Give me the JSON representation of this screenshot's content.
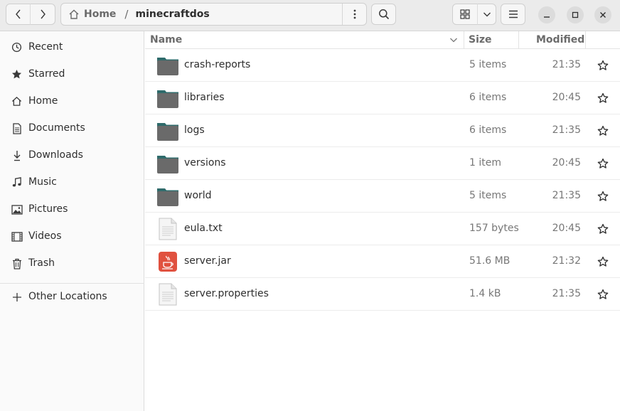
{
  "path": {
    "home": "Home",
    "current": "minecraftdos"
  },
  "sidebar": {
    "items": [
      {
        "label": "Recent",
        "icon": "clock-icon"
      },
      {
        "label": "Starred",
        "icon": "star-icon"
      },
      {
        "label": "Home",
        "icon": "home-icon"
      },
      {
        "label": "Documents",
        "icon": "document-icon"
      },
      {
        "label": "Downloads",
        "icon": "download-icon"
      },
      {
        "label": "Music",
        "icon": "music-icon"
      },
      {
        "label": "Pictures",
        "icon": "picture-icon"
      },
      {
        "label": "Videos",
        "icon": "video-icon"
      },
      {
        "label": "Trash",
        "icon": "trash-icon"
      }
    ],
    "other": {
      "label": "Other Locations",
      "icon": "plus-icon"
    }
  },
  "columns": {
    "name": "Name",
    "size": "Size",
    "modified": "Modified"
  },
  "files": [
    {
      "name": "crash-reports",
      "size": "5 items",
      "modified": "21:35",
      "type": "folder"
    },
    {
      "name": "libraries",
      "size": "6 items",
      "modified": "20:45",
      "type": "folder"
    },
    {
      "name": "logs",
      "size": "6 items",
      "modified": "21:35",
      "type": "folder"
    },
    {
      "name": "versions",
      "size": "1 item",
      "modified": "20:45",
      "type": "folder"
    },
    {
      "name": "world",
      "size": "5 items",
      "modified": "21:35",
      "type": "folder"
    },
    {
      "name": "eula.txt",
      "size": "157 bytes",
      "modified": "20:45",
      "type": "text"
    },
    {
      "name": "server.jar",
      "size": "51.6 MB",
      "modified": "21:32",
      "type": "java"
    },
    {
      "name": "server.properties",
      "size": "1.4 kB",
      "modified": "21:35",
      "type": "text"
    }
  ],
  "colors": {
    "folder_tab": "#2f6b6b",
    "folder_body": "#6a6a6a",
    "java": "#e0513f"
  }
}
